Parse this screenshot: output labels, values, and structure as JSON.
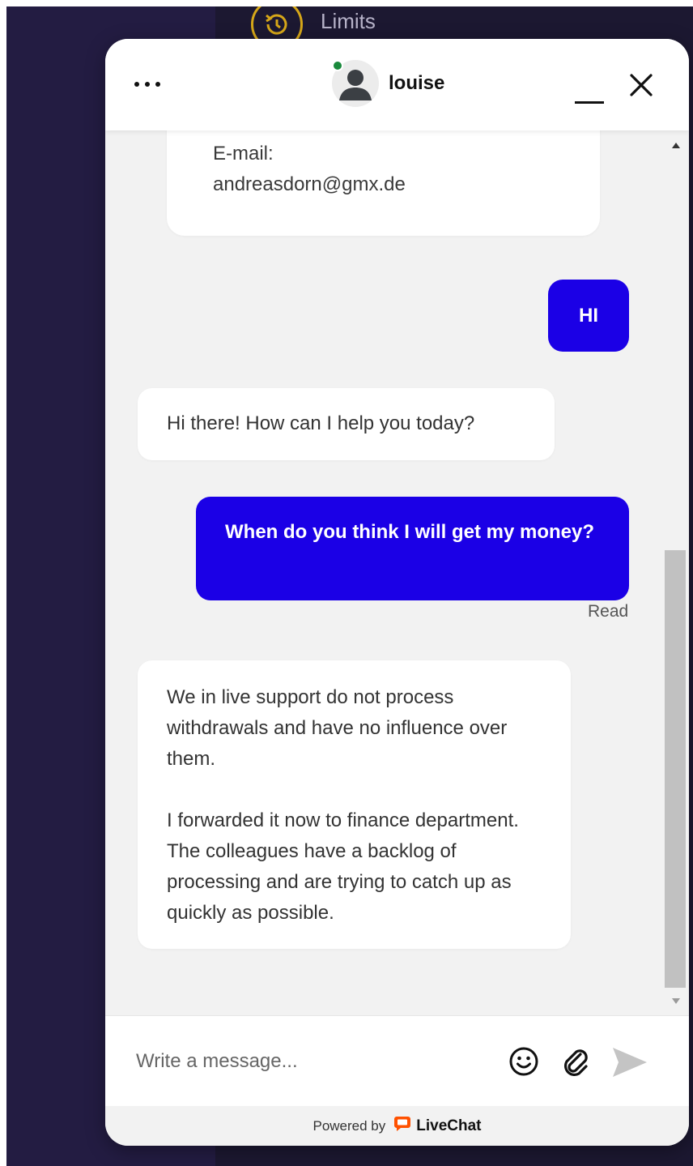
{
  "background": {
    "limits_label": "Limits"
  },
  "header": {
    "agent_name": "louise"
  },
  "messages": {
    "email_card": {
      "label": "E-mail:",
      "value": "andreasdorn@gmx.de"
    },
    "user_hi": "HI",
    "agent_greeting": "Hi there! How can I help you today?",
    "user_question": "When do you think I will get my money?",
    "read_receipt": "Read",
    "agent_reply_p1": "We in live support do not process withdrawals and have no influence over them.",
    "agent_reply_p2": "I forwarded it now to finance department. The colleagues have a backlog of processing and are trying to catch up as quickly as possible."
  },
  "composer": {
    "placeholder": "Write a message..."
  },
  "footer": {
    "powered_by": "Powered by",
    "brand": "LiveChat"
  },
  "colors": {
    "user_bubble": "#1b00e6",
    "online_status": "#19893c",
    "brand_orange": "#ff5100",
    "limits_accent": "#d6a719"
  },
  "icons": [
    "more-options-icon",
    "avatar-icon",
    "minimize-icon",
    "close-icon",
    "emoji-icon",
    "attachment-icon",
    "send-icon",
    "livechat-logo-icon",
    "limits-icon"
  ]
}
